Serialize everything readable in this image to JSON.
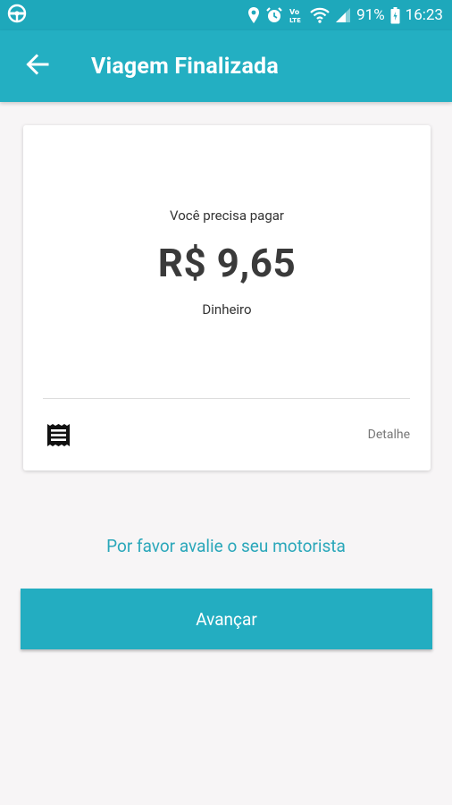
{
  "status_bar": {
    "battery": "91%",
    "time": "16:23",
    "icons": [
      "steering-wheel-icon",
      "location-pin-icon",
      "alarm-icon",
      "volte-icon",
      "wifi-icon",
      "signal-icon",
      "battery-icon"
    ]
  },
  "app_bar": {
    "title": "Viagem Finalizada",
    "back_icon": "arrow-left-icon"
  },
  "card": {
    "pay_label": "Você precisa pagar",
    "amount": "R$ 9,65",
    "payment_method": "Dinheiro",
    "receipt_icon": "receipt-icon",
    "detail_label": "Detalhe"
  },
  "rate_driver_label": "Por favor avalie o seu motorista",
  "next_button_label": "Avançar",
  "colors": {
    "primary": "#23afc2",
    "link": "#2aa7ba",
    "background": "#f7f5f6"
  }
}
